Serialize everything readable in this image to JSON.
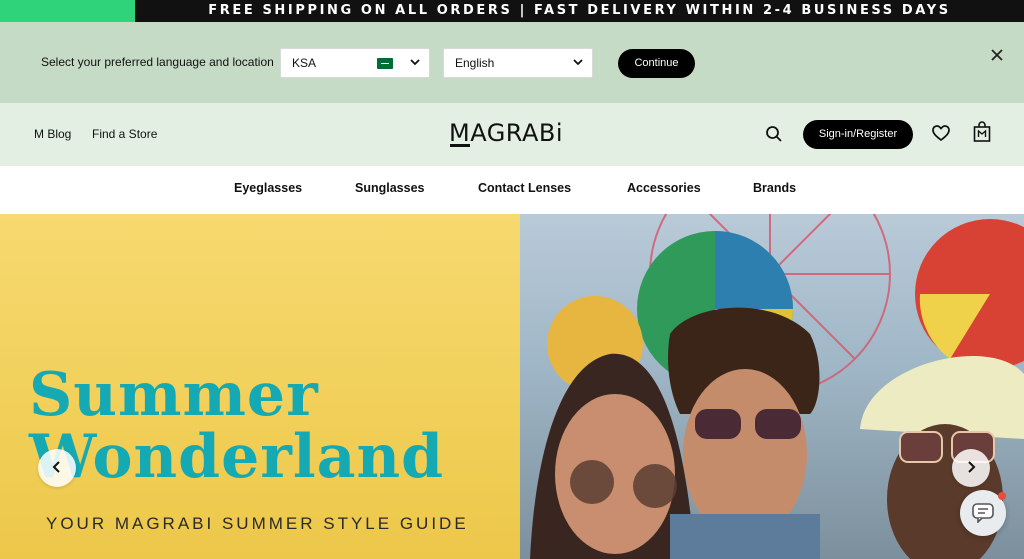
{
  "announcement": {
    "message": "FREE SHIPPING ON ALL ORDERS  |  FAST DELIVERY WITHIN 2-4 BUSINESS DAYS",
    "accent_color": "#2fd47a",
    "background_color": "#111111"
  },
  "locale_bar": {
    "prompt": "Select your preferred language and location",
    "country": {
      "value": "KSA",
      "flag_icon": "saudi-flag-icon"
    },
    "language": {
      "value": "English"
    },
    "continue_label": "Continue",
    "close_icon": "close-icon",
    "background_color": "#c6dbc6"
  },
  "header": {
    "links": [
      "M Blog",
      "Find a Store"
    ],
    "logo": "MAGRABi",
    "signin_label": "Sign-in/Register",
    "icons": [
      "search-icon",
      "heart-icon",
      "shopping-bag-icon"
    ],
    "background_color": "#e3efe3"
  },
  "nav": {
    "categories": [
      "Eyeglasses",
      "Sunglasses",
      "Contact Lenses",
      "Accessories",
      "Brands"
    ]
  },
  "hero": {
    "headline_line1": "Summer",
    "headline_line2": "Wonderland",
    "tagline": "YOUR MAGRABI SUMMER STYLE GUIDE",
    "headline_color": "#15a9b3",
    "panel_color": "#f1cf58",
    "prev_icon": "chevron-left-icon",
    "next_icon": "chevron-right-icon",
    "chat_icon": "chat-icon"
  }
}
